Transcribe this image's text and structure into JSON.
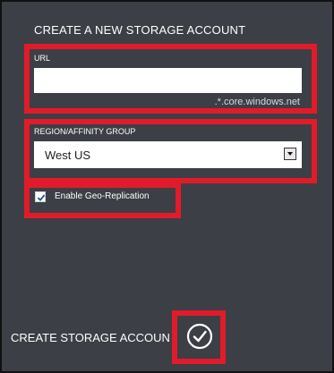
{
  "dialog": {
    "title": "CREATE A NEW STORAGE ACCOUNT"
  },
  "url": {
    "label": "URL",
    "value": "",
    "suffix": ".*.core.windows.net"
  },
  "region": {
    "label": "REGION/AFFINITY GROUP",
    "selected": "West US"
  },
  "geo_replication": {
    "label": "Enable Geo-Replication",
    "checked": true
  },
  "footer": {
    "create_label": "CREATE STORAGE ACCOUN"
  },
  "icons": {
    "check": "checkmark-icon",
    "confirm": "circle-check-icon",
    "dropdown": "chevron-down-icon"
  },
  "colors": {
    "background": "#3c3f45",
    "highlight": "#e21b2a",
    "text": "#ffffff"
  }
}
